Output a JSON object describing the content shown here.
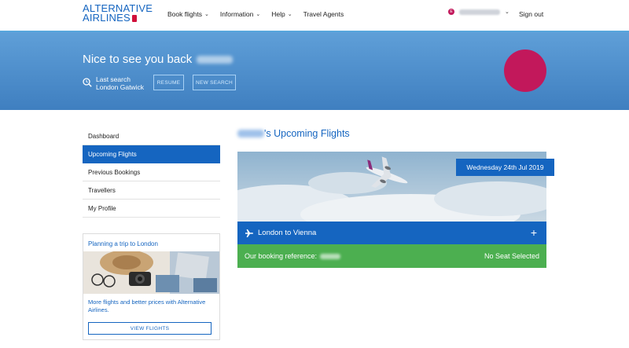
{
  "brand": {
    "line1": "ALTERNATIVE",
    "line2": "AIRLINES",
    "brand_color": "#1565c0",
    "tag_color": "#d0103a"
  },
  "nav": {
    "items": [
      {
        "label": "Book flights",
        "has_dropdown": true
      },
      {
        "label": "Information",
        "has_dropdown": true
      },
      {
        "label": "Help",
        "has_dropdown": true
      },
      {
        "label": "Travel Agents",
        "has_dropdown": false
      }
    ],
    "account_dropdown_icon": "chevron-down-icon",
    "sign_out": "Sign out"
  },
  "hero": {
    "greeting": "Nice to see you back",
    "last_search_label": "Last search",
    "last_search_value": "London Gatwick",
    "resume_label": "RESUME",
    "new_search_label": "NEW SEARCH",
    "background": "#4a8bcb",
    "avatar_color": "#c2185b"
  },
  "sidebar": {
    "items": [
      {
        "label": "Dashboard",
        "active": false
      },
      {
        "label": "Upcoming Flights",
        "active": true
      },
      {
        "label": "Previous Bookings",
        "active": false
      },
      {
        "label": "Travellers",
        "active": false
      },
      {
        "label": "My Profile",
        "active": false
      }
    ],
    "promo": {
      "title": "Planning a trip to London",
      "text": "More flights and better prices with Alternative Airlines.",
      "button": "VIEW FLIGHTS"
    }
  },
  "main": {
    "title_suffix": "'s Upcoming Flights",
    "flight": {
      "date": "Wednesday 24th Jul 2019",
      "route": "London to Vienna",
      "booking_label": "Our booking reference:",
      "seat_status": "No Seat Selected",
      "route_color": "#1565c0",
      "booking_color": "#4caf50"
    }
  }
}
